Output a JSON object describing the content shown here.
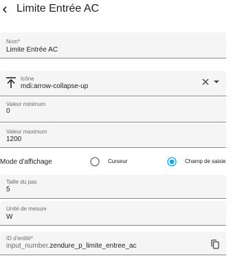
{
  "header": {
    "title": "Limite Entrée AC",
    "back_icon": "arrow-left-icon"
  },
  "form": {
    "name": {
      "label": "Nom*",
      "value": "Limite Entrée AC"
    },
    "icon": {
      "label": "Icône",
      "value": "mdi:arrow-collapse-up",
      "icon": "arrow-collapse-up-icon",
      "clear_icon": "close-icon",
      "dropdown_icon": "menu-down-icon"
    },
    "min": {
      "label": "Valeur minimum",
      "value": "0"
    },
    "max": {
      "label": "Valeur maximum",
      "value": "1200"
    },
    "mode": {
      "label": "Mode d'affichage",
      "options": [
        {
          "label": "Curseur",
          "selected": false
        },
        {
          "label": "Champ de saisie",
          "selected": true
        }
      ]
    },
    "step": {
      "label": "Taille du pas",
      "value": "5"
    },
    "unit": {
      "label": "Unité de mesure",
      "value": "W"
    },
    "entity_id": {
      "label": "ID d'entité*",
      "prefix": "input_number.",
      "value": "zendure_p_limite_entree_ac",
      "copy_icon": "copy-icon"
    }
  },
  "colors": {
    "accent": "#03a9f4",
    "field_bg": "#f5f5f5",
    "label": "#6b6b6b"
  }
}
